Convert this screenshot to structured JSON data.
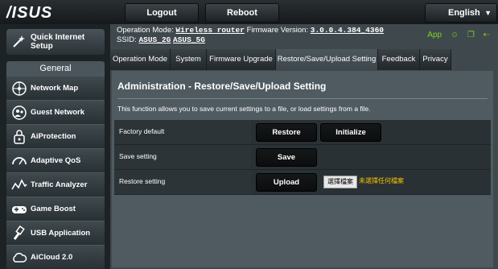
{
  "header": {
    "logo": "/ISUS",
    "logout_label": "Logout",
    "reboot_label": "Reboot",
    "language": "English"
  },
  "sidebar": {
    "quick_internet_setup_line1": "Quick Internet",
    "quick_internet_setup_line2": "Setup",
    "section_label": "General",
    "items": [
      {
        "label": "Network Map",
        "icon": "network-map-icon"
      },
      {
        "label": "Guest Network",
        "icon": "guest-network-icon"
      },
      {
        "label": "AiProtection",
        "icon": "lock-icon"
      },
      {
        "label": "Adaptive QoS",
        "icon": "gauge-icon"
      },
      {
        "label": "Traffic Analyzer",
        "icon": "traffic-icon"
      },
      {
        "label": "Game Boost",
        "icon": "gamepad-icon"
      },
      {
        "label": "USB Application",
        "icon": "usb-icon"
      },
      {
        "label": "AiCloud 2.0",
        "icon": "cloud-icon"
      }
    ]
  },
  "status": {
    "op_mode_label": "Operation Mode:",
    "op_mode_value": "Wireless router",
    "firmware_label": "Firmware Version:",
    "firmware_value": "3.0.0.4.384_4360",
    "ssid_label": "SSID:",
    "ssid_2g": "ASUS_2G",
    "ssid_5g": "ASUS_5G",
    "app_label": "App",
    "accent_color": "#7ed321"
  },
  "tabs": [
    {
      "label": "Operation Mode"
    },
    {
      "label": "System"
    },
    {
      "label": "Firmware Upgrade"
    },
    {
      "label": "Restore/Save/Upload Setting"
    },
    {
      "label": "Feedback"
    },
    {
      "label": "Privacy"
    }
  ],
  "panel": {
    "title": "Administration - Restore/Save/Upload Setting",
    "description": "This function allows you to save current settings to a file, or load settings from a file.",
    "rows": [
      {
        "label": "Factory default",
        "buttons": [
          "Restore",
          "Initialize"
        ]
      },
      {
        "label": "Save setting",
        "buttons": [
          "Save"
        ]
      },
      {
        "label": "Restore setting",
        "buttons": [
          "Upload"
        ],
        "file_button": "選擇檔案",
        "no_file_text": "未選擇任何檔案"
      }
    ]
  }
}
